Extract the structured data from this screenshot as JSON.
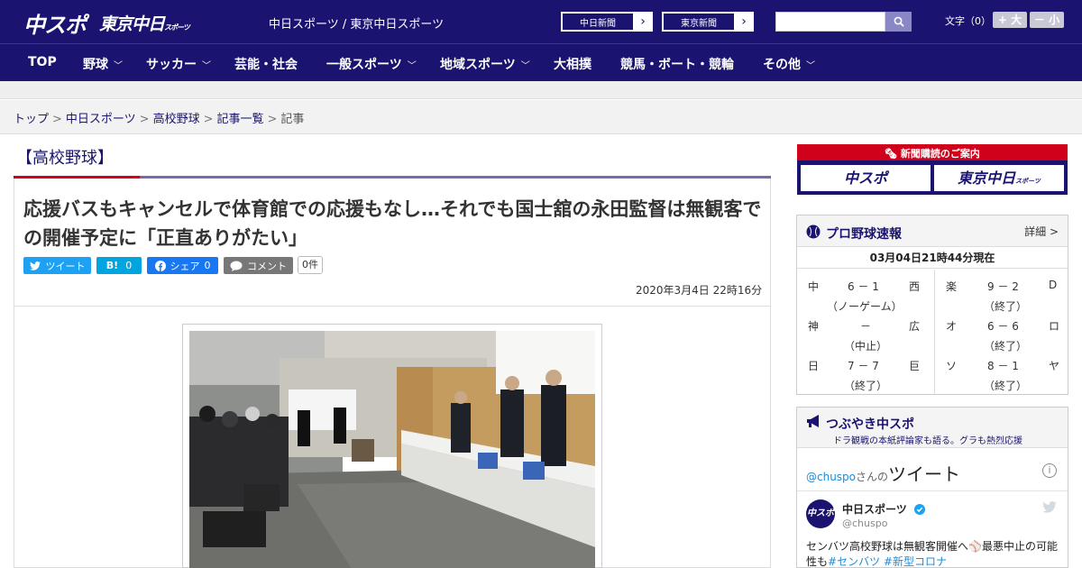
{
  "header": {
    "logo_main": "中スポ",
    "logo_tokyo": "東京中日",
    "logo_tokyo_small": "スポーツ",
    "site_name": "中日スポーツ / 東京中日スポーツ",
    "ext_links": [
      {
        "label": "中日新聞"
      },
      {
        "label": "東京新聞"
      }
    ],
    "search": {
      "placeholder": ""
    },
    "font_size_label": "文字（0）",
    "font_plus": "+ 大",
    "font_minus": "－ 小"
  },
  "nav": {
    "items": [
      {
        "label": "TOP",
        "has_dropdown": false
      },
      {
        "label": "野球",
        "has_dropdown": true
      },
      {
        "label": "サッカー",
        "has_dropdown": true
      },
      {
        "label": "芸能・社会",
        "has_dropdown": false
      },
      {
        "label": "一般スポーツ",
        "has_dropdown": true
      },
      {
        "label": "地域スポーツ",
        "has_dropdown": true
      },
      {
        "label": "大相撲",
        "has_dropdown": false
      },
      {
        "label": "競馬・ボート・競輪",
        "has_dropdown": false
      },
      {
        "label": "その他",
        "has_dropdown": true
      }
    ]
  },
  "breadcrumb": {
    "items": [
      "トップ",
      "中日スポーツ",
      "高校野球",
      "記事一覧",
      "記事"
    ]
  },
  "article": {
    "category": "【高校野球】",
    "headline": "応援バスもキャンセルで体育館での応援もなし…それでも国士舘の永田監督は無観客での開催予定に「正直ありがたい」",
    "share": {
      "tweet": "ツイート",
      "hatena": "B!",
      "hatena_count": "0",
      "facebook": "シェア",
      "facebook_count": "0",
      "comment": "コメント",
      "comment_count": "0件"
    },
    "date": "2020年3月4日 22時16分"
  },
  "sidebar": {
    "ad": {
      "title": "新聞購読のご案内",
      "logo1": "中スポ",
      "logo2": "東京中日",
      "logo2_small": "スポーツ"
    },
    "scores": {
      "title": "プロ野球速報",
      "more": "詳細 >",
      "timestamp": "03月04日21時44分現在",
      "games": [
        {
          "home": "中",
          "score": "6 － 1",
          "away": "西",
          "status": "（ノーゲーム）"
        },
        {
          "home": "楽",
          "score": "9 － 2",
          "away": "D",
          "status": "（終了）"
        },
        {
          "home": "神",
          "score": "－",
          "away": "広",
          "status": "（中止）"
        },
        {
          "home": "オ",
          "score": "6 － 6",
          "away": "ロ",
          "status": "（終了）"
        },
        {
          "home": "日",
          "score": "7 － 7",
          "away": "巨",
          "status": "（終了）"
        },
        {
          "home": "ソ",
          "score": "8 － 1",
          "away": "ヤ",
          "status": "（終了）"
        }
      ]
    },
    "twitter": {
      "title": "つぶやき中スポ",
      "subtitle": "ドラ観戦の本紙評論家も語る。グラも熱烈応援",
      "handle_link": "@chuspo",
      "handle_suffix": "さんの",
      "heading": "ツイート",
      "info": "i",
      "avatar": "中スポ",
      "account_name": "中日スポーツ",
      "account_handle": "@chuspo",
      "tweet_text": "センバツ高校野球は無観客開催へ",
      "tweet_text2": "最悪中止の可能性も",
      "tag1": "#センバツ",
      "tag2": "#新型コロナ"
    }
  },
  "colors": {
    "brand_navy": "#1a1470",
    "accent_red": "#d0021b",
    "twitter_blue": "#1da1f2",
    "facebook_blue": "#1877f2",
    "hatena_blue": "#00a4de"
  }
}
